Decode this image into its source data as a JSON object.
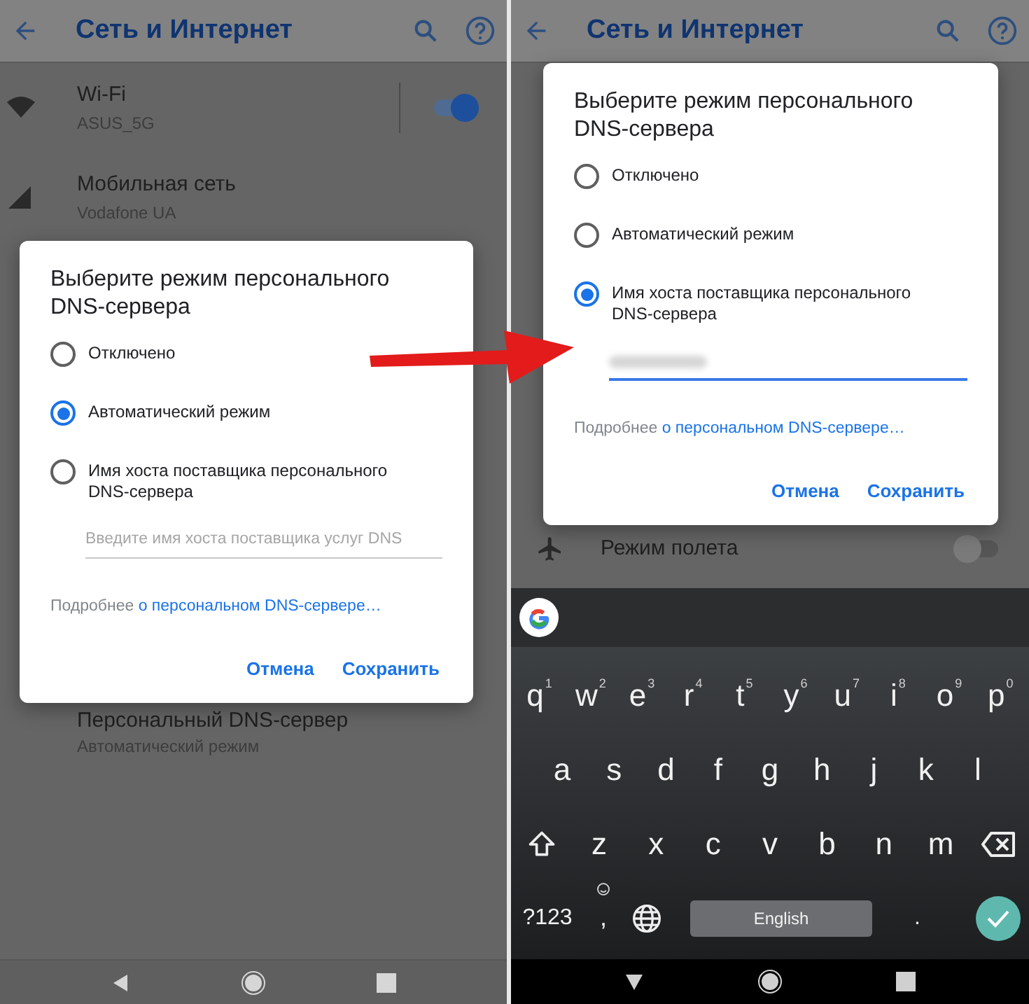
{
  "left_screen": {
    "header": {
      "title": "Сеть и Интернет"
    },
    "settings": [
      {
        "title": "Wi-Fi",
        "subtitle": "ASUS_5G",
        "on": true
      },
      {
        "title": "Мобильная сеть",
        "subtitle": "Vodafone UA"
      }
    ],
    "covered_setting": {
      "title": "Персональный DNS-сервер",
      "subtitle": "Автоматический режим"
    },
    "dialog": {
      "title": "Выберите режим персонального DNS-сервера",
      "options": [
        {
          "label": "Отключено",
          "selected": false
        },
        {
          "label": "Автоматический режим",
          "selected": true
        },
        {
          "label": "Имя хоста поставщика персонального DNS-сервера",
          "selected": false
        }
      ],
      "field": {
        "placeholder": "Введите имя хоста поставщика услуг DNS",
        "focused": false
      },
      "more_text": "Подробнее",
      "link": "о персональном DNS-сервере…",
      "buttons": [
        "Отмена",
        "Сохранить"
      ]
    }
  },
  "right_screen": {
    "header": {
      "title": "Сеть и Интернет"
    },
    "settings": [
      {
        "title": "Режим полета",
        "on": false
      }
    ],
    "dialog": {
      "title": "Выберите режим персонального DNS-сервера",
      "options": [
        {
          "label": "Отключено",
          "selected": false
        },
        {
          "label": "Автоматический режим",
          "selected": false
        },
        {
          "label": "Имя хоста поставщика персонального DNS-сервера",
          "selected": true
        }
      ],
      "field": {
        "focused": true
      },
      "more_text": "Подробнее",
      "link": "о персональном DNS-сервере…",
      "buttons": [
        "Отмена",
        "Сохранить"
      ]
    },
    "keyboard": {
      "rows": [
        [
          {
            "label": "q",
            "hint": "1"
          },
          {
            "label": "w",
            "hint": "2"
          },
          {
            "label": "e",
            "hint": "3"
          },
          {
            "label": "r",
            "hint": "4"
          },
          {
            "label": "t",
            "hint": "5"
          },
          {
            "label": "y",
            "hint": "6"
          },
          {
            "label": "u",
            "hint": "7"
          },
          {
            "label": "i",
            "hint": "8"
          },
          {
            "label": "o",
            "hint": "9"
          },
          {
            "label": "p",
            "hint": "0"
          }
        ],
        [
          {
            "label": "a"
          },
          {
            "label": "s"
          },
          {
            "label": "d"
          },
          {
            "label": "f"
          },
          {
            "label": "g"
          },
          {
            "label": "h"
          },
          {
            "label": "j"
          },
          {
            "label": "k"
          },
          {
            "label": "l"
          }
        ],
        [
          {
            "kind": "shift"
          },
          {
            "label": "z"
          },
          {
            "label": "x"
          },
          {
            "label": "c"
          },
          {
            "label": "v"
          },
          {
            "label": "b"
          },
          {
            "label": "n"
          },
          {
            "label": "m"
          },
          {
            "kind": "backspace"
          }
        ]
      ],
      "symbols_key": "?123",
      "comma_key": ",",
      "space_key": "English",
      "period_key": "."
    }
  }
}
